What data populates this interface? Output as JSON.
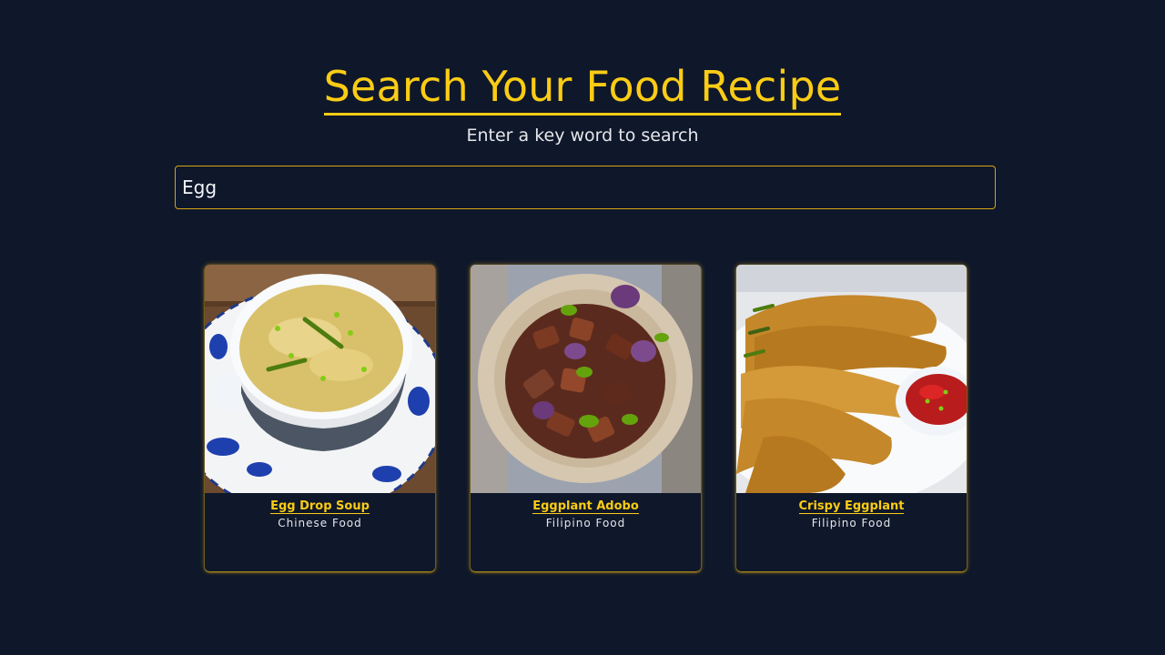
{
  "header": {
    "title": "Search Your Food Recipe",
    "subtitle": "Enter a key word to search"
  },
  "search": {
    "value": "Egg",
    "placeholder": ""
  },
  "results": [
    {
      "name": "Egg Drop Soup",
      "category": "Chinese Food",
      "image": "soup-bowl-image"
    },
    {
      "name": "Eggplant Adobo",
      "category": "Filipino Food",
      "image": "eggplant-bowl-image"
    },
    {
      "name": "Crispy Eggplant",
      "category": "Filipino Food",
      "image": "fried-eggplant-image"
    }
  ],
  "colors": {
    "background": "#0f172a",
    "accent": "#facc15",
    "text": "#e5e7eb"
  }
}
